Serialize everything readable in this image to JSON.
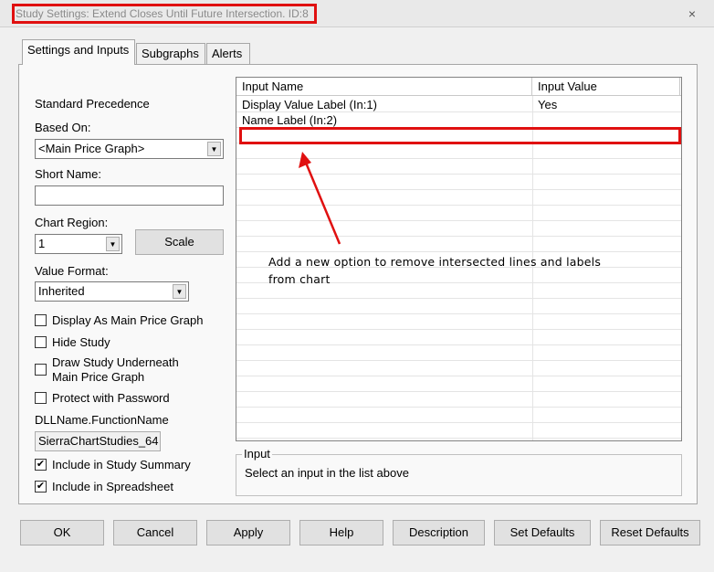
{
  "window": {
    "title": "Study Settings: Extend Closes Until Future Intersection. ID:8",
    "close_icon": "×"
  },
  "tabs": [
    {
      "label": "Settings and Inputs"
    },
    {
      "label": "Subgraphs"
    },
    {
      "label": "Alerts"
    }
  ],
  "settings": {
    "standard_precedence": "Standard Precedence",
    "based_on_label": "Based On:",
    "based_on_value": "<Main Price Graph>",
    "short_name_label": "Short Name:",
    "short_name_value": "",
    "chart_region_label": "Chart Region:",
    "chart_region_value": "1",
    "scale_button": "Scale",
    "value_format_label": "Value Format:",
    "value_format_value": "Inherited",
    "checkboxes": [
      {
        "label": "Display As Main Price Graph",
        "checked": false,
        "mark": ""
      },
      {
        "label": "Hide Study",
        "checked": false,
        "mark": ""
      },
      {
        "label": "Draw Study Underneath",
        "label2": "Main Price Graph",
        "checked": false,
        "mark": ""
      },
      {
        "label": "Protect with Password",
        "checked": false,
        "mark": ""
      }
    ],
    "dll_label": "DLLName.FunctionName",
    "dll_value": "SierraChartStudies_64",
    "checkboxes2": [
      {
        "label": "Include in Study Summary",
        "checked": true,
        "mark": "✔"
      },
      {
        "label": "Include in Spreadsheet",
        "checked": true,
        "mark": "✔"
      }
    ]
  },
  "inputs_table": {
    "columns": [
      "Input Name",
      "Input Value"
    ],
    "rows": [
      {
        "name": "Display Value Label  (In:1)",
        "value": "Yes"
      },
      {
        "name": "Name Label  (In:2)",
        "value": ""
      }
    ]
  },
  "annotation": {
    "line1": "Add a new option to remove intersected lines and labels",
    "line2": "from chart",
    "color": "#e01010"
  },
  "input_group": {
    "title": "Input",
    "text": "Select an input in the list above"
  },
  "buttons": {
    "ok": "OK",
    "cancel": "Cancel",
    "apply": "Apply",
    "help": "Help",
    "description": "Description",
    "set_defaults": "Set Defaults",
    "reset_defaults": "Reset Defaults"
  }
}
